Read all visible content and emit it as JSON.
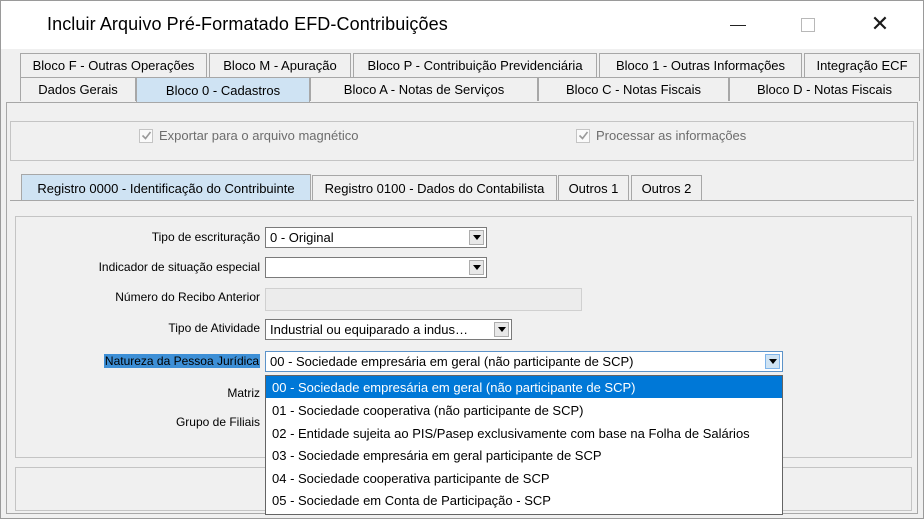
{
  "window": {
    "title": "Incluir Arquivo Pré-Formatado EFD-Contribuições",
    "minimize_glyph": "—",
    "close_glyph": "✕"
  },
  "tabs_row1": [
    {
      "label": "Bloco F - Outras Operações"
    },
    {
      "label": "Bloco M - Apuração"
    },
    {
      "label": "Bloco P - Contribuição Previdenciária"
    },
    {
      "label": "Bloco 1 - Outras Informações"
    },
    {
      "label": "Integração ECF"
    }
  ],
  "tabs_row2": [
    {
      "label": "Dados Gerais"
    },
    {
      "label": "Bloco 0 - Cadastros",
      "active": true
    },
    {
      "label": "Bloco A - Notas de Serviços"
    },
    {
      "label": "Bloco C - Notas Fiscais"
    },
    {
      "label": "Bloco D - Notas Fiscais"
    }
  ],
  "options": {
    "exportar_label": "Exportar para o arquivo magnético",
    "exportar_checked": true,
    "processar_label": "Processar as informações",
    "processar_checked": true
  },
  "subtabs": [
    {
      "label": "Registro 0000 - Identificação do Contribuinte",
      "active": true
    },
    {
      "label": "Registro 0100 - Dados do Contabilista"
    },
    {
      "label": "Outros 1"
    },
    {
      "label": "Outros 2"
    }
  ],
  "form": {
    "tipo_escrituracao_label": "Tipo de escrituração",
    "tipo_escrituracao_value": "0 - Original",
    "indicador_label": "Indicador de situação especial",
    "indicador_value": "",
    "numero_recibo_label": "Número do Recibo Anterior",
    "numero_recibo_value": "",
    "tipo_atividade_label": "Tipo de Atividade",
    "tipo_atividade_value": "Industrial ou equiparado a indus…",
    "natureza_label": "Natureza da Pessoa Jurídica",
    "natureza_value": "00 - Sociedade empresária em geral (não participante de SCP)",
    "matriz_label": "Matriz",
    "grupo_filiais_label": "Grupo de Filiais"
  },
  "natureza_options": [
    "00 - Sociedade empresária em geral (não participante de SCP)",
    "01 - Sociedade cooperativa (não participante de SCP)",
    "02 - Entidade sujeita ao PIS/Pasep exclusivamente com base na Folha de Salários",
    "03 - Sociedade empresária em geral participante de SCP",
    "04 - Sociedade cooperativa participante de SCP",
    "05 - Sociedade em Conta de Participação - SCP"
  ],
  "natureza_highlighted_index": 0,
  "colors": {
    "active_tab": "#cfe3f3",
    "highlight": "#0078d7",
    "label_selection": "#3d8fd6",
    "window_bg": "#f0f0f0"
  }
}
